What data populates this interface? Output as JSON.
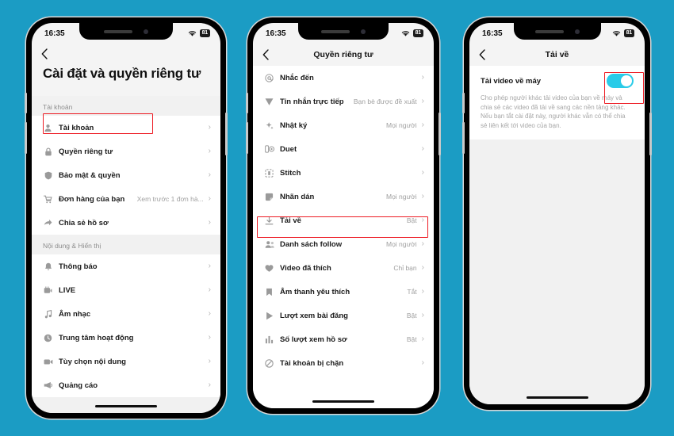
{
  "meta": {
    "background_color": "#1b9cc4",
    "accent_color": "#29cbe8",
    "highlight_color": "#ed1c24"
  },
  "status_bar": {
    "time": "16:35",
    "wifi_icon": "wifi-icon",
    "battery": "81"
  },
  "phone1": {
    "nav": {
      "back_icon": "back-chevron-icon",
      "title": ""
    },
    "page_title": "Cài đặt và quyền riêng tư",
    "sections": [
      {
        "header": "Tài khoản",
        "rows": [
          {
            "icon": "person-icon",
            "label": "Tài khoản",
            "value": "",
            "chevron": "›"
          },
          {
            "icon": "lock-icon",
            "label": "Quyền riêng tư",
            "value": "",
            "chevron": "›"
          },
          {
            "icon": "shield-icon",
            "label": "Bảo mật & quyền",
            "value": "",
            "chevron": "›",
            "highlighted": true
          },
          {
            "icon": "cart-icon",
            "label": "Đơn hàng của bạn",
            "value": "Xem trước 1 đơn hà...",
            "chevron": "›"
          },
          {
            "icon": "share-icon",
            "label": "Chia sẻ hồ sơ",
            "value": "",
            "chevron": "›"
          }
        ]
      },
      {
        "header": "Nội dung & Hiển thị",
        "rows": [
          {
            "icon": "bell-icon",
            "label": "Thông báo",
            "value": "",
            "chevron": "›"
          },
          {
            "icon": "live-icon",
            "label": "LIVE",
            "value": "",
            "chevron": "›"
          },
          {
            "icon": "music-icon",
            "label": "Âm nhạc",
            "value": "",
            "chevron": "›"
          },
          {
            "icon": "clock-icon",
            "label": "Trung tâm hoạt động",
            "value": "",
            "chevron": "›"
          },
          {
            "icon": "video-icon",
            "label": "Tùy chọn nội dung",
            "value": "",
            "chevron": "›"
          },
          {
            "icon": "megaphone-icon",
            "label": "Quảng cáo",
            "value": "",
            "chevron": "›"
          }
        ]
      }
    ]
  },
  "phone2": {
    "nav": {
      "back_icon": "back-chevron-icon",
      "title": "Quyền riêng tư"
    },
    "rows": [
      {
        "icon": "at-icon",
        "label": "Nhắc đến",
        "value": "",
        "chevron": "›"
      },
      {
        "icon": "send-icon",
        "label": "Tin nhắn trực tiếp",
        "value": "Bạn bè được đề xuất",
        "chevron": "›"
      },
      {
        "icon": "sparkle-icon",
        "label": "Nhật ký",
        "value": "Mọi người",
        "chevron": "›"
      },
      {
        "icon": "duet-icon",
        "label": "Duet",
        "value": "",
        "chevron": "›"
      },
      {
        "icon": "stitch-icon",
        "label": "Stitch",
        "value": "",
        "chevron": "›"
      },
      {
        "icon": "sticker-icon",
        "label": "Nhãn dán",
        "value": "Mọi người",
        "chevron": "›"
      },
      {
        "icon": "download-icon",
        "label": "Tải về",
        "value": "Bật",
        "chevron": "›",
        "highlighted": true
      },
      {
        "icon": "people-icon",
        "label": "Danh sách follow",
        "value": "Mọi người",
        "chevron": "›"
      },
      {
        "icon": "heart-icon",
        "label": "Video đã thích",
        "value": "Chỉ bạn",
        "chevron": "›"
      },
      {
        "icon": "bookmark-icon",
        "label": "Âm thanh yêu thích",
        "value": "Tắt",
        "chevron": "›"
      },
      {
        "icon": "play-icon",
        "label": "Lượt xem bài đăng",
        "value": "Bật",
        "chevron": "›"
      },
      {
        "icon": "chart-icon",
        "label": "Số lượt xem hồ sơ",
        "value": "Bật",
        "chevron": "›"
      },
      {
        "icon": "block-icon",
        "label": "Tài khoản bị chặn",
        "value": "",
        "chevron": "›"
      }
    ]
  },
  "phone3": {
    "nav": {
      "back_icon": "back-chevron-icon",
      "title": "Tải về"
    },
    "toggle": {
      "title": "Tải video về máy",
      "state_on": true,
      "description": "Cho phép người khác tải video của bạn về máy và chia sẻ các video đã tải về sang các nền tảng khác. Nếu bạn tắt cài đặt này, người khác vẫn có thể chia sẻ liên kết tới video của bạn."
    }
  }
}
